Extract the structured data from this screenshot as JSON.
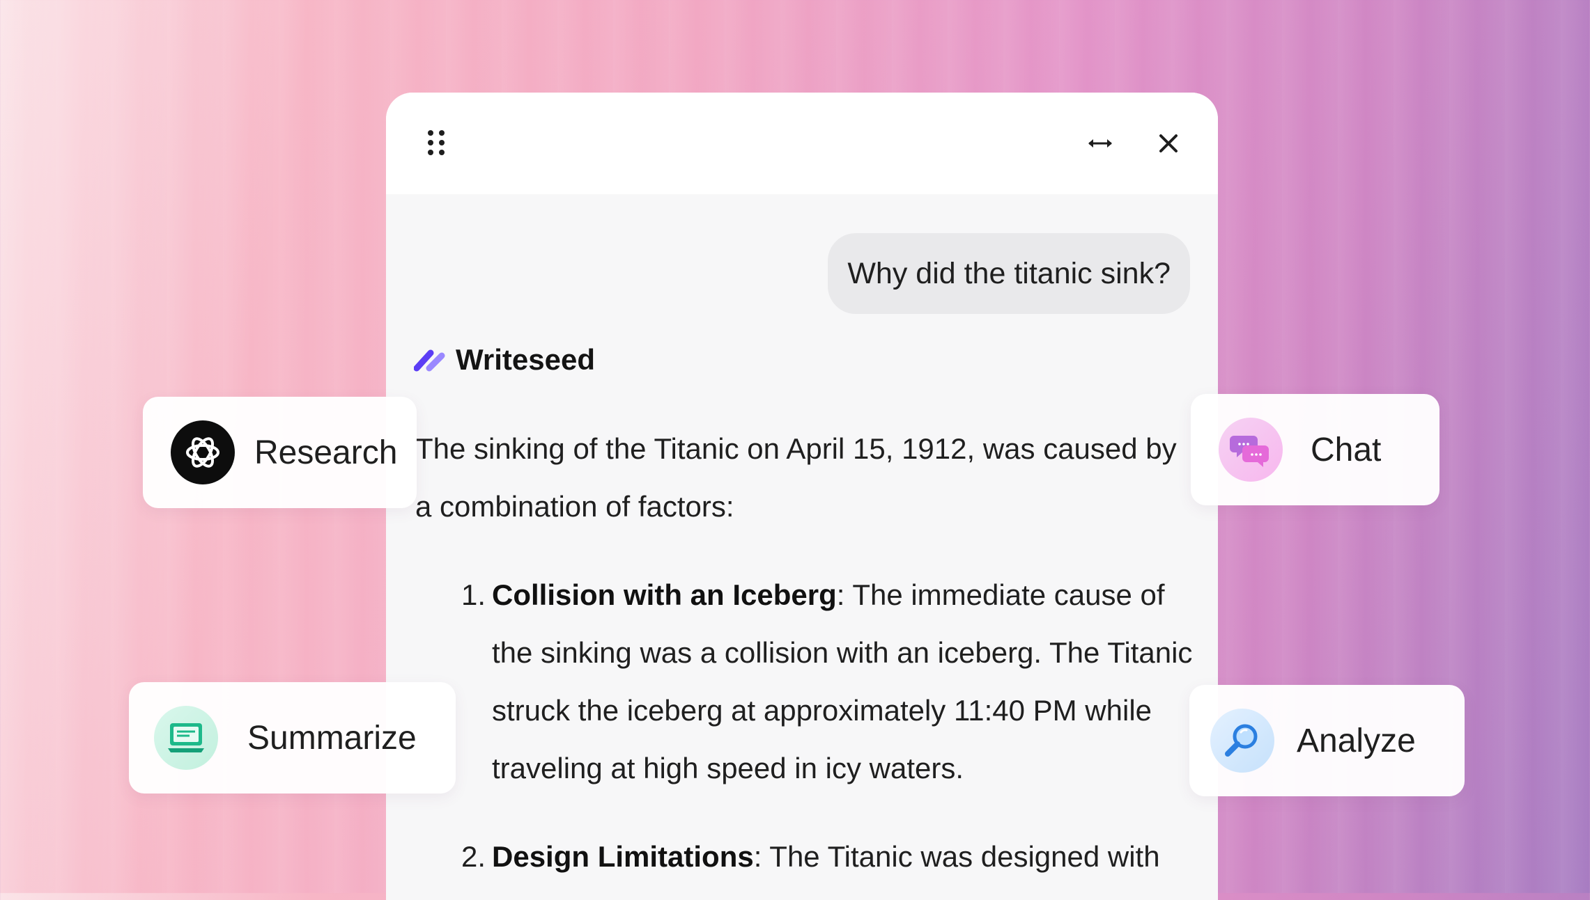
{
  "widget": {
    "user_message": "Why did the titanic sink?",
    "assistant_name": "Writeseed",
    "answer_intro": "The sinking of the Titanic on April 15, 1912, was caused by a combination of factors:",
    "points": [
      {
        "number": "1.",
        "title": "Collision with an Iceberg",
        "text": ": The immediate cause of the sinking was a collision with an iceberg. The Titanic struck the iceberg at approximately 11:40 PM while traveling at high speed in icy waters."
      },
      {
        "number": "2.",
        "title": "Design Limitations",
        "text": ": The Titanic was designed with"
      }
    ]
  },
  "features": {
    "research": "Research",
    "chat": "Chat",
    "summarize": "Summarize",
    "analyze": "Analyze"
  },
  "colors": {
    "brand_purple": "#5b3df5",
    "brand_light": "#9a88ff",
    "chat_pink": "#e56ad9",
    "summarize_green": "#1db98a",
    "analyze_blue": "#2b7fe0"
  },
  "icons": [
    "drag-handle-icon",
    "expand-horizontal-icon",
    "close-icon",
    "writeseed-logo-icon",
    "openai-icon",
    "chat-bubbles-icon",
    "summarize-icon",
    "magnifier-icon"
  ]
}
